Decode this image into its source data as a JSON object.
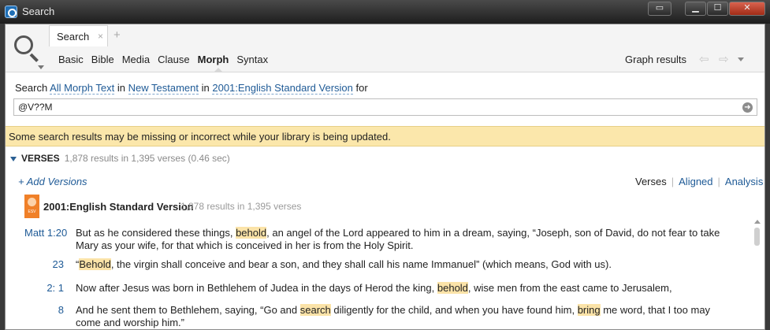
{
  "window": {
    "title": "Search",
    "buttons": {
      "panel": "▭",
      "minimize": "▁",
      "maximize": "☐",
      "close": "✕"
    }
  },
  "header": {
    "tab_label": "Search",
    "tab_close": "×",
    "tab_add": "+",
    "subnav": [
      "Basic",
      "Bible",
      "Media",
      "Clause",
      "Morph",
      "Syntax"
    ],
    "active_subnav": "Morph",
    "graph_results": "Graph results",
    "back": "⇦",
    "forward": "⇨"
  },
  "search": {
    "prefix": "Search",
    "scope": "All Morph Text",
    "in1": "in",
    "range": "New Testament",
    "in2": "in",
    "version": "2001:English Standard Version",
    "for": "for",
    "query": "@V??M",
    "go_glyph": "➜"
  },
  "warning": "Some search results may be missing or incorrect while your library is being updated.",
  "verses": {
    "label": "VERSES",
    "count": "1,878 results in 1,395 verses (0.46 sec)",
    "add_versions": "+ Add Versions",
    "view_tabs": {
      "verses": "Verses",
      "aligned": "Aligned",
      "analysis": "Analysis"
    }
  },
  "resource": {
    "tag": "ESV",
    "name": "2001:English Standard Version",
    "count": "1,878 results in 1,395 verses"
  },
  "results": [
    {
      "ref": "Matt 1:20",
      "parts": [
        {
          "t": "But as he considered these things, "
        },
        {
          "t": "behold",
          "hl": true
        },
        {
          "t": ", an angel of the Lord appeared to him in a dream, saying, “Joseph, son of David, do not fear to take Mary as your wife, for that which is conceived in her is from the Holy Spirit."
        }
      ]
    },
    {
      "ref": "23",
      "parts": [
        {
          "t": "“"
        },
        {
          "t": "Behold",
          "hl": true
        },
        {
          "t": ", the virgin shall conceive and bear a son, and they shall call his name Immanuel” (which means, God with us)."
        }
      ]
    },
    {
      "ref": "2:  1",
      "parts": [
        {
          "t": "Now after Jesus was born in Bethlehem of Judea in the days of Herod the king, "
        },
        {
          "t": "behold",
          "hl": true
        },
        {
          "t": ", wise men from the east came to Jerusalem,"
        }
      ]
    },
    {
      "ref": "8",
      "parts": [
        {
          "t": "And he sent them to Bethlehem, saying, “Go and "
        },
        {
          "t": "search",
          "hl": true
        },
        {
          "t": " diligently for the child, and when you have found him, "
        },
        {
          "t": "bring",
          "hl": true
        },
        {
          "t": " me word, that I too may come and worship him.”"
        }
      ]
    }
  ]
}
